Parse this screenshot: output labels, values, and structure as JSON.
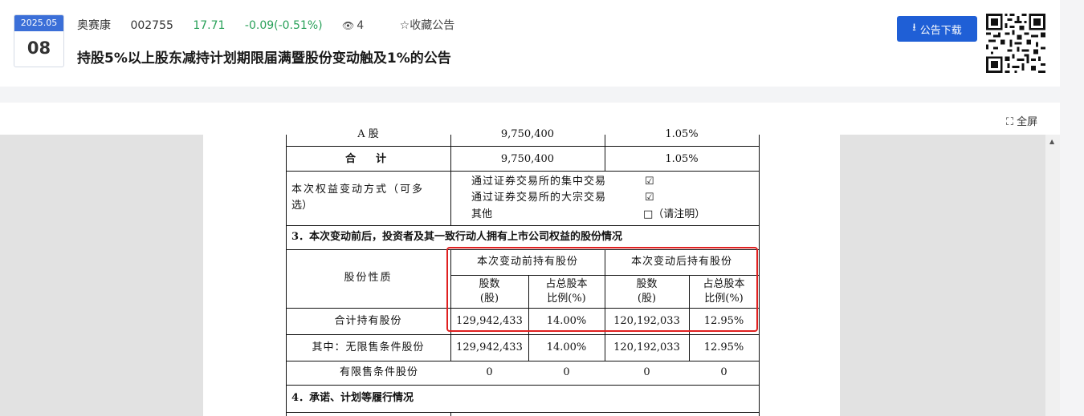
{
  "header": {
    "date_ym": "2025.05",
    "date_day": "08",
    "stock_name": "奥赛康",
    "stock_code": "002755",
    "price": "17.71",
    "change": "-0.09(-0.51%)",
    "views": "4",
    "favorite_label": "☆收藏公告",
    "title": "持股5%以上股东减持计划期限届满暨股份变动触及1%的公告",
    "download_label": "公告下载",
    "price_color": "#2aa15a",
    "accent_color": "#1f5fd6"
  },
  "viewer": {
    "fullscreen_label": "全屏"
  },
  "doc": {
    "row_a": {
      "label": "A 股",
      "shares": "9,750,400",
      "pct": "1.05%"
    },
    "row_total": {
      "label": "合　计",
      "shares": "9,750,400",
      "pct": "1.05%"
    },
    "method": {
      "label_line1": "本次权益变动方式（可多",
      "label_line2": "选）",
      "opt1": "通过证券交易所的集中交易",
      "opt1_mark": "☑",
      "opt2": "通过证券交易所的大宗交易",
      "opt2_mark": "☑",
      "opt3": "其他",
      "opt3_mark": "□（请注明）"
    },
    "section3": "3．本次变动前后，投资者及其一致行动人拥有上市公司权益的股份情况",
    "table": {
      "nature_label": "股份性质",
      "before_label": "本次变动前持有股份",
      "after_label": "本次变动后持有股份",
      "shares_l1": "股数",
      "shares_l2": "(股)",
      "pct_l1": "占总股本",
      "pct_l2": "比例(%)",
      "rows": [
        {
          "label": "合计持有股份",
          "before_shares": "129,942,433",
          "before_pct": "14.00%",
          "after_shares": "120,192,033",
          "after_pct": "12.95%"
        },
        {
          "label": "其中：无限售条件股份",
          "before_shares": "129,942,433",
          "before_pct": "14.00%",
          "after_shares": "120,192,033",
          "after_pct": "12.95%"
        },
        {
          "label": "有限售条件股份",
          "before_shares": "0",
          "before_pct": "0",
          "after_shares": "0",
          "after_pct": "0"
        }
      ]
    },
    "section4": "4．承诺、计划等履行情况"
  }
}
